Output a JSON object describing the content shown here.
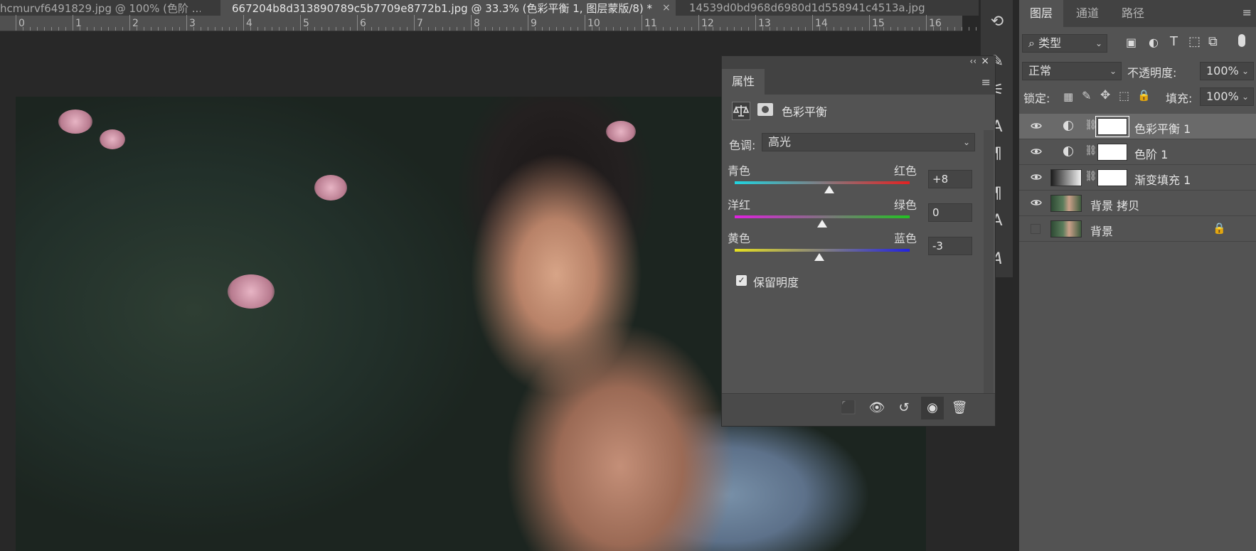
{
  "tabs": [
    {
      "label": "hcmurvf6491829.jpg @ 100% (色阶 ...",
      "close": "×",
      "active": false
    },
    {
      "label": "667204b8d313890789c5b7709e8772b1.jpg @ 33.3% (色彩平衡 1, 图层蒙版/8) *",
      "close": "×",
      "active": true
    },
    {
      "label": "14539d0bd968d6980d1d558941c4513a.jpg",
      "close": "×",
      "active": false
    }
  ],
  "ruler": {
    "labels": [
      "0",
      "1",
      "2",
      "3",
      "4",
      "5",
      "6",
      "7",
      "8",
      "9",
      "10",
      "11",
      "12",
      "13",
      "14",
      "15",
      "16"
    ]
  },
  "properties": {
    "tab": "属性",
    "adjustment_title": "色彩平衡",
    "tone_label": "色调:",
    "tone_value": "高光",
    "sliders": [
      {
        "left": "青色",
        "right": "红色",
        "value": "+8",
        "amount": 8,
        "colors": [
          "#20d4e0",
          "#e32222"
        ]
      },
      {
        "left": "洋红",
        "right": "绿色",
        "value": "0",
        "amount": 0,
        "colors": [
          "#e020e0",
          "#22c222"
        ]
      },
      {
        "left": "黄色",
        "right": "蓝色",
        "value": "-3",
        "amount": -3,
        "colors": [
          "#e6e020",
          "#2222e0"
        ]
      }
    ],
    "preserve_luminosity": "保留明度",
    "preserve_checked": true
  },
  "layers_panel": {
    "tabs": [
      "图层",
      "通道",
      "路径"
    ],
    "filter_label": "类型",
    "blend_mode": "正常",
    "opacity_label": "不透明度:",
    "opacity": "100%",
    "lock_label": "锁定:",
    "fill_label": "填充:",
    "fill": "100%",
    "layers": [
      {
        "name": "色彩平衡 1",
        "type": "adjustment",
        "visible": true,
        "selected": true
      },
      {
        "name": "色阶 1",
        "type": "adjustment",
        "visible": true,
        "selected": false
      },
      {
        "name": "渐变填充 1",
        "type": "gradient",
        "visible": true,
        "selected": false
      },
      {
        "name": "背景 拷贝",
        "type": "image",
        "visible": true,
        "selected": false
      },
      {
        "name": "背景",
        "type": "image",
        "visible": false,
        "selected": false,
        "locked": true
      }
    ]
  },
  "icons": {
    "search": "search-icon",
    "eye": "eye-icon",
    "lock": "lock-icon",
    "trash": "trash-icon"
  }
}
